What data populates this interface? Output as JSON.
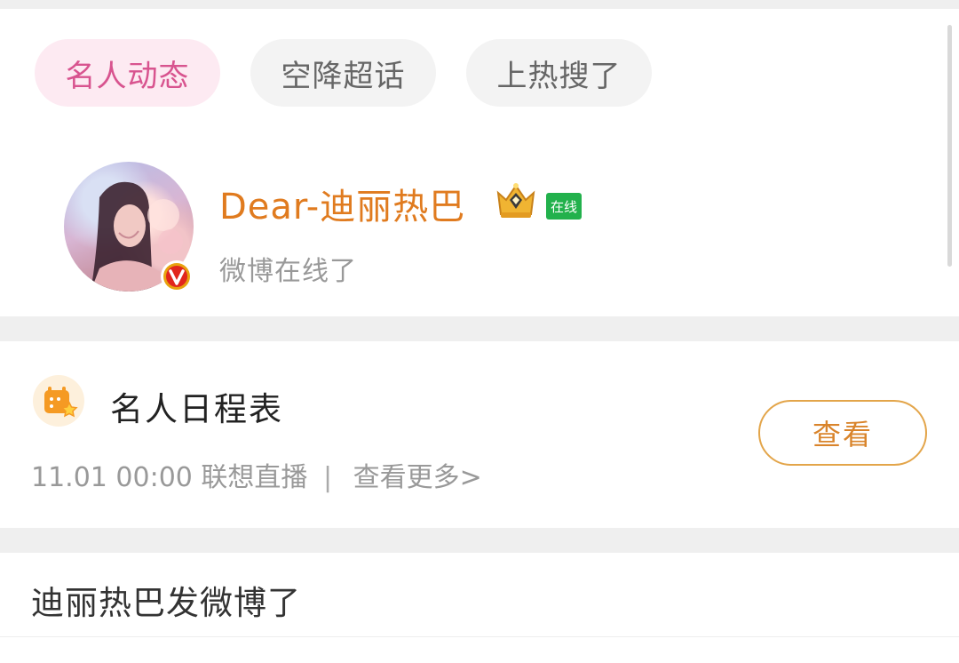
{
  "tabs": [
    {
      "label": "名人动态",
      "active": true
    },
    {
      "label": "空降超话",
      "active": false
    },
    {
      "label": "上热搜了",
      "active": false
    }
  ],
  "profile": {
    "username": "Dear-迪丽热巴",
    "online_badge": "在线",
    "status": "微博在线了",
    "verified_badge": "V",
    "icons": [
      "avatar",
      "verified-v-icon",
      "crown-icon"
    ]
  },
  "schedule": {
    "title": "名人日程表",
    "time": "11.01 00:00",
    "event": "联想直播",
    "separator": "|",
    "more_link": "查看更多>",
    "view_button": "查看",
    "icon": "calendar-star-icon"
  },
  "post": {
    "title": "迪丽热巴发微博了"
  },
  "colors": {
    "accent_orange": "#e07b1f",
    "active_tab_text": "#d8548f",
    "active_tab_bg": "#fdeaf2",
    "online_green": "#22b14c"
  }
}
